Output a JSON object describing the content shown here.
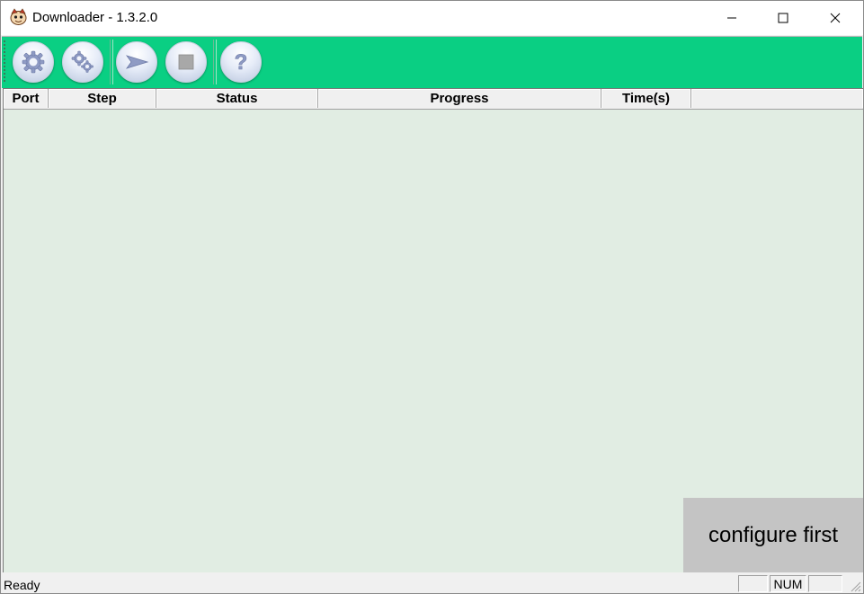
{
  "window": {
    "title": "Downloader - 1.3.2.0",
    "controls": [
      "minimize-icon",
      "maximize-icon",
      "close-icon"
    ]
  },
  "toolbar": {
    "buttons": [
      {
        "name": "settings-button",
        "icon": "gear-icon"
      },
      {
        "name": "advanced-settings-button",
        "icon": "gears-icon"
      },
      {
        "name": "start-button",
        "icon": "play-arrow-icon"
      },
      {
        "name": "stop-button",
        "icon": "stop-icon"
      },
      {
        "name": "help-button",
        "icon": "question-icon"
      }
    ],
    "accent": "#0acf83"
  },
  "table": {
    "columns": [
      "Port",
      "Step",
      "Status",
      "Progress",
      "Time(s)"
    ],
    "rows": [],
    "background": "#e1ede3"
  },
  "overlay": {
    "message": "configure first"
  },
  "statusbar": {
    "text": "Ready",
    "panes": [
      "",
      "NUM",
      ""
    ]
  }
}
